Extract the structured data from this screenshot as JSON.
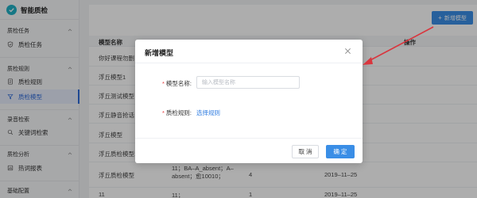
{
  "app": {
    "title": "智能质检"
  },
  "sidebar": {
    "groups": [
      {
        "title": "质检任务",
        "items": [
          {
            "label": "质检任务",
            "icon": "shield-check-icon"
          }
        ]
      },
      {
        "title": "质检规则",
        "items": [
          {
            "label": "质检规则",
            "icon": "document-icon"
          },
          {
            "label": "质检模型",
            "icon": "filter-icon",
            "active": true
          }
        ]
      },
      {
        "title": "录音检索",
        "items": [
          {
            "label": "关键词检索",
            "icon": "search-icon"
          }
        ]
      },
      {
        "title": "质检分析",
        "items": [
          {
            "label": "热词报表",
            "icon": "report-icon"
          }
        ]
      },
      {
        "title": "基础配置",
        "items": []
      }
    ]
  },
  "toolbar": {
    "add_label": "新增模型"
  },
  "table": {
    "headers": [
      "模型名称",
      "操作"
    ],
    "rows": [
      [
        "你好课程勿删"
      ],
      [
        "浮丘模型1"
      ],
      [
        "浮丘测试模型"
      ],
      [
        "浮丘静音抢话"
      ],
      [
        "浮丘模型"
      ],
      [
        "浮丘质检模型1"
      ],
      [
        "浮丘质检模型",
        "11；BA–A_absent；A–absent；愈10010；",
        "4",
        "2019–11–25"
      ],
      [
        "11",
        "11；",
        "1",
        "2019–11–25"
      ]
    ]
  },
  "modal": {
    "title": "新增模型",
    "name_label": "模型名称:",
    "name_placeholder": "输入模型名称",
    "rule_label": "质检规则:",
    "rule_link": "选择规则",
    "cancel_label": "取 消",
    "ok_label": "确 定"
  },
  "colors": {
    "primary": "#3a8ee6",
    "required": "#e4393c",
    "annotation": "#d9363e"
  }
}
